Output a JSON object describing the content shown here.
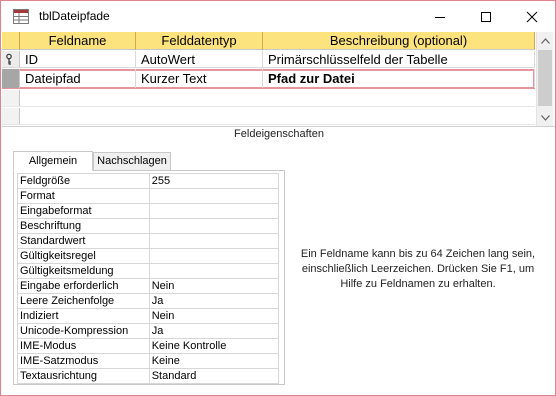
{
  "window": {
    "title": "tblDateipfade"
  },
  "grid": {
    "columns": [
      "Feldname",
      "Felddatentyp",
      "Beschreibung (optional)"
    ],
    "rows": [
      {
        "name": "ID",
        "type": "AutoWert",
        "description": "Primärschlüsselfeld der Tabelle",
        "primary_key": true
      },
      {
        "name": "Dateipfad",
        "type": "Kurzer Text",
        "description": "Pfad zur Datei",
        "selected": true
      }
    ]
  },
  "properties": {
    "section_title": "Feldeigenschaften",
    "tabs": [
      "Allgemein",
      "Nachschlagen"
    ],
    "active_tab": "Allgemein",
    "items": [
      {
        "name": "Feldgröße",
        "value": "255"
      },
      {
        "name": "Format",
        "value": ""
      },
      {
        "name": "Eingabeformat",
        "value": ""
      },
      {
        "name": "Beschriftung",
        "value": ""
      },
      {
        "name": "Standardwert",
        "value": ""
      },
      {
        "name": "Gültigkeitsregel",
        "value": ""
      },
      {
        "name": "Gültigkeitsmeldung",
        "value": ""
      },
      {
        "name": "Eingabe erforderlich",
        "value": "Nein"
      },
      {
        "name": "Leere Zeichenfolge",
        "value": "Ja"
      },
      {
        "name": "Indiziert",
        "value": "Nein"
      },
      {
        "name": "Unicode-Kompression",
        "value": "Ja"
      },
      {
        "name": "IME-Modus",
        "value": "Keine Kontrolle"
      },
      {
        "name": "IME-Satzmodus",
        "value": "Keine"
      },
      {
        "name": "Textausrichtung",
        "value": "Standard"
      }
    ],
    "help_text": "Ein Feldname kann bis zu 64 Zeichen lang sein, einschließlich Leerzeichen. Drücken Sie F1, um Hilfe zu Feldnamen zu erhalten."
  },
  "colors": {
    "header_bg": "#fde37e",
    "selection_outline": "#e8949c",
    "window_border": "#e0828c"
  },
  "icons": [
    "table-icon",
    "key-icon",
    "minimize-icon",
    "maximize-icon",
    "close-icon",
    "scroll-up-icon",
    "scroll-down-icon"
  ]
}
